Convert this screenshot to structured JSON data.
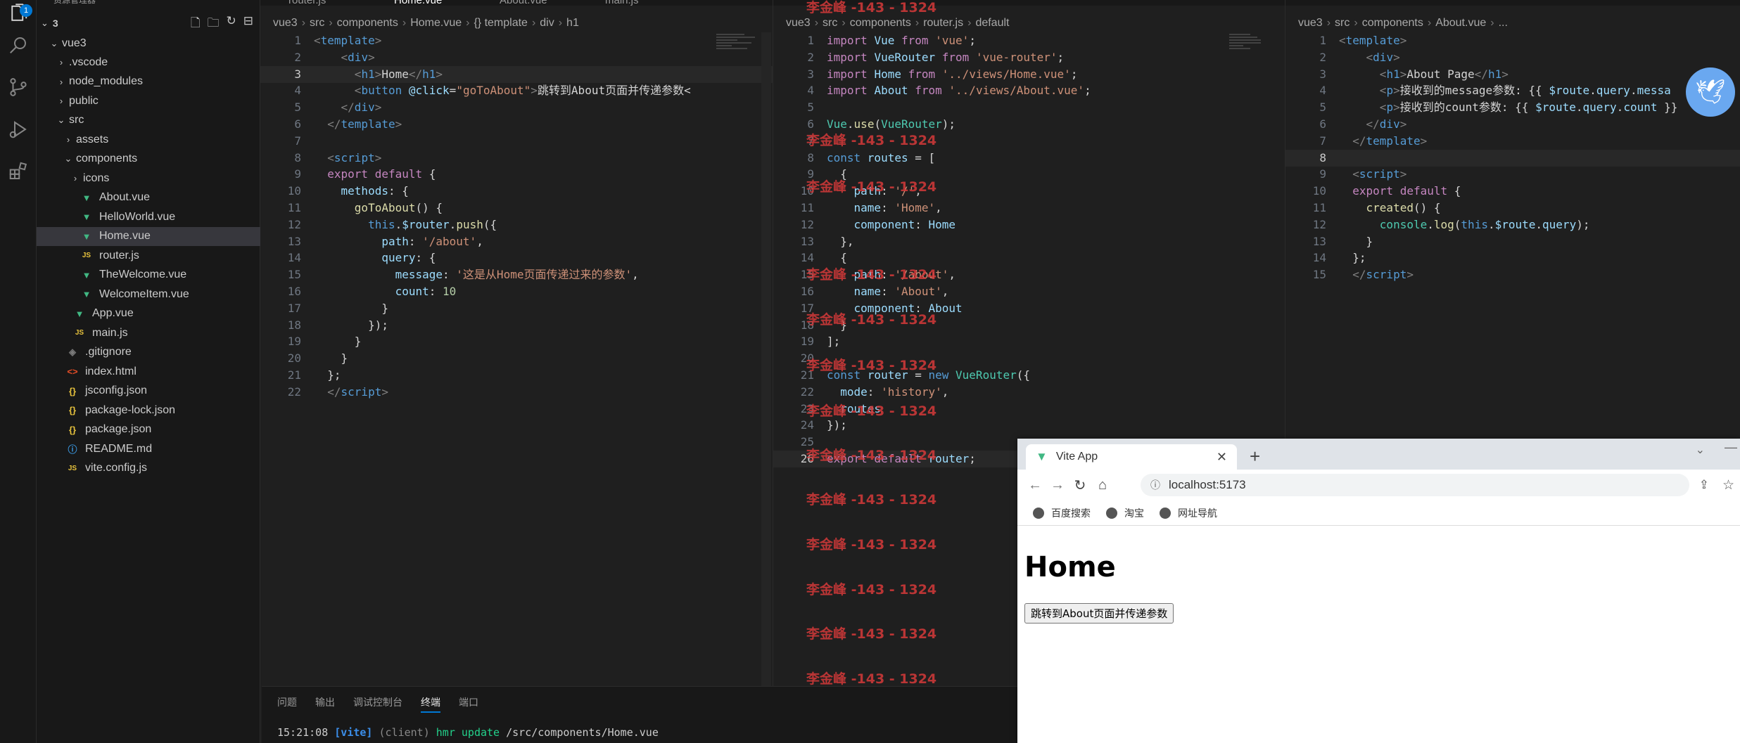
{
  "activity": {
    "badge": "1"
  },
  "sidebar": {
    "top_text": "资源管理器",
    "root": "3",
    "items": [
      {
        "label": "vue3",
        "type": "folder-open",
        "depth": 1
      },
      {
        "label": ".vscode",
        "type": "folder",
        "depth": 2
      },
      {
        "label": "node_modules",
        "type": "folder",
        "depth": 2
      },
      {
        "label": "public",
        "type": "folder",
        "depth": 2
      },
      {
        "label": "src",
        "type": "folder-open",
        "depth": 2
      },
      {
        "label": "assets",
        "type": "folder",
        "depth": 3
      },
      {
        "label": "components",
        "type": "folder-open",
        "depth": 3
      },
      {
        "label": "icons",
        "type": "folder",
        "depth": 4
      },
      {
        "label": "About.vue",
        "type": "vue",
        "depth": 4
      },
      {
        "label": "HelloWorld.vue",
        "type": "vue",
        "depth": 4
      },
      {
        "label": "Home.vue",
        "type": "vue",
        "depth": 4,
        "selected": true
      },
      {
        "label": "router.js",
        "type": "js",
        "depth": 4
      },
      {
        "label": "TheWelcome.vue",
        "type": "vue",
        "depth": 4
      },
      {
        "label": "WelcomeItem.vue",
        "type": "vue",
        "depth": 4
      },
      {
        "label": "App.vue",
        "type": "vue",
        "depth": 3
      },
      {
        "label": "main.js",
        "type": "js",
        "depth": 3
      },
      {
        "label": ".gitignore",
        "type": "git",
        "depth": 2
      },
      {
        "label": "index.html",
        "type": "html",
        "depth": 2
      },
      {
        "label": "jsconfig.json",
        "type": "json",
        "depth": 2
      },
      {
        "label": "package-lock.json",
        "type": "json",
        "depth": 2
      },
      {
        "label": "package.json",
        "type": "json",
        "depth": 2
      },
      {
        "label": "README.md",
        "type": "info",
        "depth": 2
      },
      {
        "label": "vite.config.js",
        "type": "js",
        "depth": 2
      }
    ]
  },
  "editor1": {
    "tabs": [
      "router.js",
      "Home.vue",
      "About.vue",
      "main.js"
    ],
    "crumbs": [
      "vue3",
      "src",
      "components",
      "Home.vue",
      "{} template",
      "div",
      "h1"
    ],
    "current_line": 3,
    "lines": [
      [
        [
          "tg",
          "<"
        ],
        [
          "t",
          "template"
        ],
        [
          "tg",
          ">"
        ]
      ],
      [
        [
          "d",
          "    "
        ],
        [
          "tg",
          "<"
        ],
        [
          "t",
          "div"
        ],
        [
          "tg",
          ">"
        ]
      ],
      [
        [
          "d",
          "      "
        ],
        [
          "tg",
          "<"
        ],
        [
          "t",
          "h1"
        ],
        [
          "tg",
          ">"
        ],
        [
          "d",
          "Home"
        ],
        [
          "tg",
          "</"
        ],
        [
          "t",
          "h1"
        ],
        [
          "tg",
          ">"
        ]
      ],
      [
        [
          "d",
          "      "
        ],
        [
          "tg",
          "<"
        ],
        [
          "t",
          "button "
        ],
        [
          "a",
          "@click"
        ],
        [
          "d",
          "="
        ],
        [
          "s",
          "\"goToAbout\""
        ],
        [
          "tg",
          ">"
        ],
        [
          "d",
          "跳转到About页面并传递参数<"
        ]
      ],
      [
        [
          "d",
          "    "
        ],
        [
          "tg",
          "</"
        ],
        [
          "t",
          "div"
        ],
        [
          "tg",
          ">"
        ]
      ],
      [
        [
          "d",
          "  "
        ],
        [
          "tg",
          "</"
        ],
        [
          "t",
          "template"
        ],
        [
          "tg",
          ">"
        ]
      ],
      [
        [
          "d",
          ""
        ]
      ],
      [
        [
          "d",
          "  "
        ],
        [
          "tg",
          "<"
        ],
        [
          "t",
          "script"
        ],
        [
          "tg",
          ">"
        ]
      ],
      [
        [
          "d",
          "  "
        ],
        [
          "k",
          "export default "
        ],
        [
          "d",
          "{"
        ]
      ],
      [
        [
          "d",
          "    "
        ],
        [
          "v",
          "methods"
        ],
        [
          "d",
          ": {"
        ]
      ],
      [
        [
          "d",
          "      "
        ],
        [
          "f",
          "goToAbout"
        ],
        [
          "d",
          "() {"
        ]
      ],
      [
        [
          "d",
          "        "
        ],
        [
          "k2",
          "this"
        ],
        [
          "d",
          "."
        ],
        [
          "v",
          "$router"
        ],
        [
          "d",
          "."
        ],
        [
          "f",
          "push"
        ],
        [
          "d",
          "({"
        ]
      ],
      [
        [
          "d",
          "          "
        ],
        [
          "v",
          "path"
        ],
        [
          "d",
          ": "
        ],
        [
          "s",
          "'/about'"
        ],
        [
          "d",
          ","
        ]
      ],
      [
        [
          "d",
          "          "
        ],
        [
          "v",
          "query"
        ],
        [
          "d",
          ": {"
        ]
      ],
      [
        [
          "d",
          "            "
        ],
        [
          "v",
          "message"
        ],
        [
          "d",
          ": "
        ],
        [
          "s",
          "'这是从Home页面传递过来的参数'"
        ],
        [
          "d",
          ","
        ]
      ],
      [
        [
          "d",
          "            "
        ],
        [
          "v",
          "count"
        ],
        [
          "d",
          ": "
        ],
        [
          "n",
          "10"
        ]
      ],
      [
        [
          "d",
          "          "
        ],
        [
          "d",
          "}"
        ]
      ],
      [
        [
          "d",
          "        "
        ],
        [
          "d",
          "});"
        ]
      ],
      [
        [
          "d",
          "      "
        ],
        [
          "d",
          "}"
        ]
      ],
      [
        [
          "d",
          "    "
        ],
        [
          "d",
          "}"
        ]
      ],
      [
        [
          "d",
          "  "
        ],
        [
          "d",
          "};"
        ]
      ],
      [
        [
          "d",
          "  "
        ],
        [
          "tg",
          "</"
        ],
        [
          "t",
          "script"
        ],
        [
          "tg",
          ">"
        ]
      ]
    ]
  },
  "editor2": {
    "crumbs": [
      "vue3",
      "src",
      "components",
      "router.js",
      "default"
    ],
    "current_line": 26,
    "lines": [
      [
        [
          "k",
          "import "
        ],
        [
          "v",
          "Vue "
        ],
        [
          "k",
          "from "
        ],
        [
          "s",
          "'vue'"
        ],
        [
          "d",
          ";"
        ]
      ],
      [
        [
          "k",
          "import "
        ],
        [
          "v",
          "VueRouter "
        ],
        [
          "k",
          "from "
        ],
        [
          "s",
          "'vue-router'"
        ],
        [
          "d",
          ";"
        ]
      ],
      [
        [
          "k",
          "import "
        ],
        [
          "v",
          "Home "
        ],
        [
          "k",
          "from "
        ],
        [
          "s",
          "'../views/Home.vue'"
        ],
        [
          "d",
          ";"
        ]
      ],
      [
        [
          "k",
          "import "
        ],
        [
          "v",
          "About "
        ],
        [
          "k",
          "from "
        ],
        [
          "s",
          "'../views/About.vue'"
        ],
        [
          "d",
          ";"
        ]
      ],
      [
        [
          "d",
          ""
        ]
      ],
      [
        [
          "c",
          "Vue"
        ],
        [
          "d",
          "."
        ],
        [
          "f",
          "use"
        ],
        [
          "d",
          "("
        ],
        [
          "c",
          "VueRouter"
        ],
        [
          "d",
          ");"
        ]
      ],
      [
        [
          "d",
          ""
        ]
      ],
      [
        [
          "k2",
          "const "
        ],
        [
          "v",
          "routes "
        ],
        [
          "d",
          "= ["
        ]
      ],
      [
        [
          "d",
          "  {"
        ]
      ],
      [
        [
          "d",
          "    "
        ],
        [
          "v",
          "path"
        ],
        [
          "d",
          ": "
        ],
        [
          "s",
          "'/'"
        ],
        [
          "d",
          ","
        ]
      ],
      [
        [
          "d",
          "    "
        ],
        [
          "v",
          "name"
        ],
        [
          "d",
          ": "
        ],
        [
          "s",
          "'Home'"
        ],
        [
          "d",
          ","
        ]
      ],
      [
        [
          "d",
          "    "
        ],
        [
          "v",
          "component"
        ],
        [
          "d",
          ": "
        ],
        [
          "v",
          "Home"
        ]
      ],
      [
        [
          "d",
          "  },"
        ]
      ],
      [
        [
          "d",
          "  {"
        ]
      ],
      [
        [
          "d",
          "    "
        ],
        [
          "v",
          "path"
        ],
        [
          "d",
          ": "
        ],
        [
          "s",
          "'/about'"
        ],
        [
          "d",
          ","
        ]
      ],
      [
        [
          "d",
          "    "
        ],
        [
          "v",
          "name"
        ],
        [
          "d",
          ": "
        ],
        [
          "s",
          "'About'"
        ],
        [
          "d",
          ","
        ]
      ],
      [
        [
          "d",
          "    "
        ],
        [
          "v",
          "component"
        ],
        [
          "d",
          ": "
        ],
        [
          "v",
          "About"
        ]
      ],
      [
        [
          "d",
          "  }"
        ]
      ],
      [
        [
          "d",
          "];"
        ]
      ],
      [
        [
          "d",
          ""
        ]
      ],
      [
        [
          "k2",
          "const "
        ],
        [
          "v",
          "router "
        ],
        [
          "d",
          "= "
        ],
        [
          "k2",
          "new "
        ],
        [
          "c",
          "VueRouter"
        ],
        [
          "d",
          "({"
        ]
      ],
      [
        [
          "d",
          "  "
        ],
        [
          "v",
          "mode"
        ],
        [
          "d",
          ": "
        ],
        [
          "s",
          "'history'"
        ],
        [
          "d",
          ","
        ]
      ],
      [
        [
          "d",
          "  "
        ],
        [
          "v",
          "routes"
        ]
      ],
      [
        [
          "d",
          "});"
        ]
      ],
      [
        [
          "d",
          ""
        ]
      ],
      [
        [
          "k",
          "export default "
        ],
        [
          "v",
          "router"
        ],
        [
          "d",
          ";"
        ]
      ]
    ]
  },
  "editor3": {
    "crumbs": [
      "vue3",
      "src",
      "components",
      "About.vue",
      "..."
    ],
    "current_line": 8,
    "lines": [
      [
        [
          "tg",
          "<"
        ],
        [
          "t",
          "template"
        ],
        [
          "tg",
          ">"
        ]
      ],
      [
        [
          "d",
          "    "
        ],
        [
          "tg",
          "<"
        ],
        [
          "t",
          "div"
        ],
        [
          "tg",
          ">"
        ]
      ],
      [
        [
          "d",
          "      "
        ],
        [
          "tg",
          "<"
        ],
        [
          "t",
          "h1"
        ],
        [
          "tg",
          ">"
        ],
        [
          "d",
          "About Page"
        ],
        [
          "tg",
          "</"
        ],
        [
          "t",
          "h1"
        ],
        [
          "tg",
          ">"
        ]
      ],
      [
        [
          "d",
          "      "
        ],
        [
          "tg",
          "<"
        ],
        [
          "t",
          "p"
        ],
        [
          "tg",
          ">"
        ],
        [
          "d",
          "接收到的message参数: "
        ],
        [
          "d",
          "{{ "
        ],
        [
          "v",
          "$route"
        ],
        [
          "d",
          "."
        ],
        [
          "v",
          "query"
        ],
        [
          "d",
          "."
        ],
        [
          "v",
          "messa"
        ]
      ],
      [
        [
          "d",
          "      "
        ],
        [
          "tg",
          "<"
        ],
        [
          "t",
          "p"
        ],
        [
          "tg",
          ">"
        ],
        [
          "d",
          "接收到的count参数: "
        ],
        [
          "d",
          "{{ "
        ],
        [
          "v",
          "$route"
        ],
        [
          "d",
          "."
        ],
        [
          "v",
          "query"
        ],
        [
          "d",
          "."
        ],
        [
          "v",
          "count "
        ],
        [
          "d",
          "}}"
        ]
      ],
      [
        [
          "d",
          "    "
        ],
        [
          "tg",
          "</"
        ],
        [
          "t",
          "div"
        ],
        [
          "tg",
          ">"
        ]
      ],
      [
        [
          "d",
          "  "
        ],
        [
          "tg",
          "</"
        ],
        [
          "t",
          "template"
        ],
        [
          "tg",
          ">"
        ]
      ],
      [
        [
          "d",
          ""
        ]
      ],
      [
        [
          "d",
          "  "
        ],
        [
          "tg",
          "<"
        ],
        [
          "t",
          "script"
        ],
        [
          "tg",
          ">"
        ]
      ],
      [
        [
          "d",
          "  "
        ],
        [
          "k",
          "export default "
        ],
        [
          "d",
          "{"
        ]
      ],
      [
        [
          "d",
          "    "
        ],
        [
          "f",
          "created"
        ],
        [
          "d",
          "() {"
        ]
      ],
      [
        [
          "d",
          "      "
        ],
        [
          "c",
          "console"
        ],
        [
          "d",
          "."
        ],
        [
          "f",
          "log"
        ],
        [
          "d",
          "("
        ],
        [
          "k2",
          "this"
        ],
        [
          "d",
          "."
        ],
        [
          "v",
          "$route"
        ],
        [
          "d",
          "."
        ],
        [
          "v",
          "query"
        ],
        [
          "d",
          ");"
        ]
      ],
      [
        [
          "d",
          "    "
        ],
        [
          "d",
          "}"
        ]
      ],
      [
        [
          "d",
          "  "
        ],
        [
          "d",
          "};"
        ]
      ],
      [
        [
          "d",
          "  "
        ],
        [
          "tg",
          "</"
        ],
        [
          "t",
          "script"
        ],
        [
          "tg",
          ">"
        ]
      ]
    ]
  },
  "watermark": "李金峰 -143 - 1324",
  "panel": {
    "tabs": [
      "问题",
      "输出",
      "调试控制台",
      "终端",
      "端口"
    ],
    "active_tab": "终端",
    "terminal": {
      "time": "15:21:08",
      "tag": "[vite]",
      "client": "(client)",
      "action": "hmr update",
      "path": "/src/components/Home.vue"
    }
  },
  "browser": {
    "tab_title": "Vite App",
    "url": "localhost:5173",
    "bookmarks": [
      "百度搜索",
      "淘宝",
      "网址导航"
    ],
    "page_heading": "Home",
    "page_button": "跳转到About页面并传递参数"
  }
}
